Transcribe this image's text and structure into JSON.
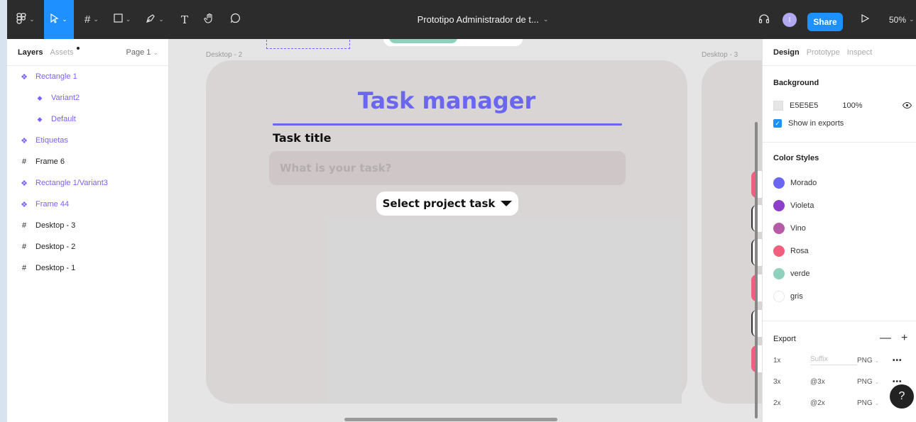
{
  "toolbar": {
    "file_title": "Prototipo Administrador de t...",
    "avatar_initial": "I",
    "share_label": "Share",
    "zoom": "50%"
  },
  "left_panel": {
    "tabs": [
      "Layers",
      "Assets"
    ],
    "page": "Page 1",
    "layers": [
      {
        "label": "Rectangle 1",
        "kind": "component",
        "indent": 0
      },
      {
        "label": "Variant2",
        "kind": "component",
        "indent": 1
      },
      {
        "label": "Default",
        "kind": "component",
        "indent": 1
      },
      {
        "label": "Etiquetas",
        "kind": "component",
        "indent": 0
      },
      {
        "label": "Frame 6",
        "kind": "frame",
        "indent": 0
      },
      {
        "label": "Rectangle 1/Variant3",
        "kind": "component",
        "indent": 0
      },
      {
        "label": "Frame 44",
        "kind": "component",
        "indent": 0
      },
      {
        "label": "Desktop - 3",
        "kind": "frame",
        "indent": 0
      },
      {
        "label": "Desktop - 2",
        "kind": "frame",
        "indent": 0
      },
      {
        "label": "Desktop - 1",
        "kind": "frame",
        "indent": 0
      }
    ]
  },
  "canvas": {
    "frame_labels": [
      "Desktop - 2",
      "Desktop - 3"
    ],
    "task_manager_title": "Task manager",
    "task_title_label": "Task title",
    "task_input_placeholder": "What is your task?",
    "select_project_label": "Select project task"
  },
  "right_panel": {
    "tabs": [
      "Design",
      "Prototype",
      "Inspect"
    ],
    "background_title": "Background",
    "background_hex": "E5E5E5",
    "background_opacity": "100%",
    "show_in_exports": "Show in exports",
    "color_styles_title": "Color Styles",
    "color_styles": [
      {
        "name": "Morado",
        "color": "#6b66f0"
      },
      {
        "name": "Violeta",
        "color": "#8e3fc9"
      },
      {
        "name": "Vino",
        "color": "#b75aa8"
      },
      {
        "name": "Rosa",
        "color": "#f25f7e"
      },
      {
        "name": "verde",
        "color": "#8ed1bd"
      },
      {
        "name": "gris",
        "color": "#ffffff"
      }
    ],
    "export_title": "Export",
    "exports": [
      {
        "scale": "1x",
        "suffix": "Suffix",
        "format": "PNG"
      },
      {
        "scale": "3x",
        "suffix": "@3x",
        "format": "PNG"
      },
      {
        "scale": "2x",
        "suffix": "@2x",
        "format": "PNG"
      }
    ]
  },
  "help_label": "?"
}
